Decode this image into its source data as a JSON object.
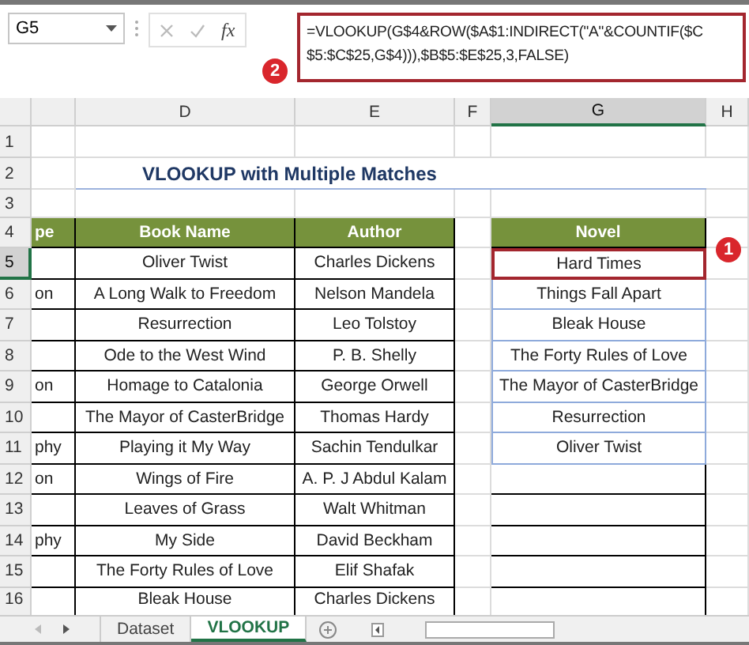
{
  "name_box": {
    "value": "G5"
  },
  "formula_bar": {
    "function_button": "fx",
    "formula": "=VLOOKUP(G$4&ROW($A$1:INDIRECT(\"A\"&COUNTIF($C$5:$C$25,G$4))),$B$5:$E$25,3,FALSE)"
  },
  "callouts": [
    {
      "label": "2"
    },
    {
      "label": "1"
    }
  ],
  "columns": [
    {
      "label": "D",
      "selected": false
    },
    {
      "label": "E",
      "selected": false
    },
    {
      "label": "F",
      "selected": false
    },
    {
      "label": "G",
      "selected": true
    },
    {
      "label": "H",
      "selected": false
    }
  ],
  "rows": [
    {
      "number": "1",
      "selected": false
    },
    {
      "number": "2",
      "selected": false
    },
    {
      "number": "3",
      "selected": false
    },
    {
      "number": "4",
      "selected": false
    },
    {
      "number": "5",
      "selected": true
    },
    {
      "number": "6",
      "selected": false
    },
    {
      "number": "7",
      "selected": false
    },
    {
      "number": "8",
      "selected": false
    },
    {
      "number": "9",
      "selected": false
    },
    {
      "number": "10",
      "selected": false
    },
    {
      "number": "11",
      "selected": false
    },
    {
      "number": "12",
      "selected": false
    },
    {
      "number": "13",
      "selected": false
    },
    {
      "number": "14",
      "selected": false
    },
    {
      "number": "15",
      "selected": false
    },
    {
      "number": "16",
      "selected": false
    }
  ],
  "title": "VLOOKUP with Multiple Matches",
  "table": {
    "columns": [
      "pe",
      "Book Name",
      "Author"
    ],
    "rows": [
      {
        "book": "Oliver Twist",
        "author": "Charles Dickens"
      },
      {
        "column_c": "on",
        "book": "A Long Walk to Freedom",
        "author": "Nelson Mandela"
      },
      {
        "book": "Resurrection",
        "author": "Leo Tolstoy"
      },
      {
        "book": "Ode to the West Wind",
        "author": "P. B. Shelly"
      },
      {
        "column_c": "on",
        "book": "Homage to Catalonia",
        "author": "George Orwell"
      },
      {
        "book": "The Mayor of CasterBridge",
        "author": "Thomas Hardy"
      },
      {
        "column_c": "phy",
        "book": "Playing it My Way",
        "author": "Sachin Tendulkar"
      },
      {
        "column_c": "on",
        "book": "Wings of Fire",
        "author": "A. P. J Abdul Kalam"
      },
      {
        "book": "Leaves of Grass",
        "author": "Walt Whitman"
      },
      {
        "column_c": "phy",
        "book": "My Side",
        "author": "David Beckham"
      },
      {
        "book": "The Forty Rules of Love",
        "author": "Elif Shafak"
      },
      {
        "book": "Bleak House",
        "author": "Charles Dickens"
      }
    ]
  },
  "result": {
    "header": "Novel",
    "cells": [
      {
        "value": "Hard Times",
        "selected": true
      },
      {
        "value": "Things Fall Apart",
        "selected": false
      },
      {
        "value": "Bleak House",
        "selected": false
      },
      {
        "value": "The Forty Rules of Love",
        "selected": false
      },
      {
        "value": "The Mayor of CasterBridge",
        "selected": false
      },
      {
        "value": "Resurrection",
        "selected": false
      },
      {
        "value": "Oliver Twist",
        "selected": false
      }
    ]
  },
  "sheet_tabs": [
    {
      "label": "Dataset",
      "selected": false
    },
    {
      "label": "VLOOKUP",
      "selected": true
    }
  ]
}
